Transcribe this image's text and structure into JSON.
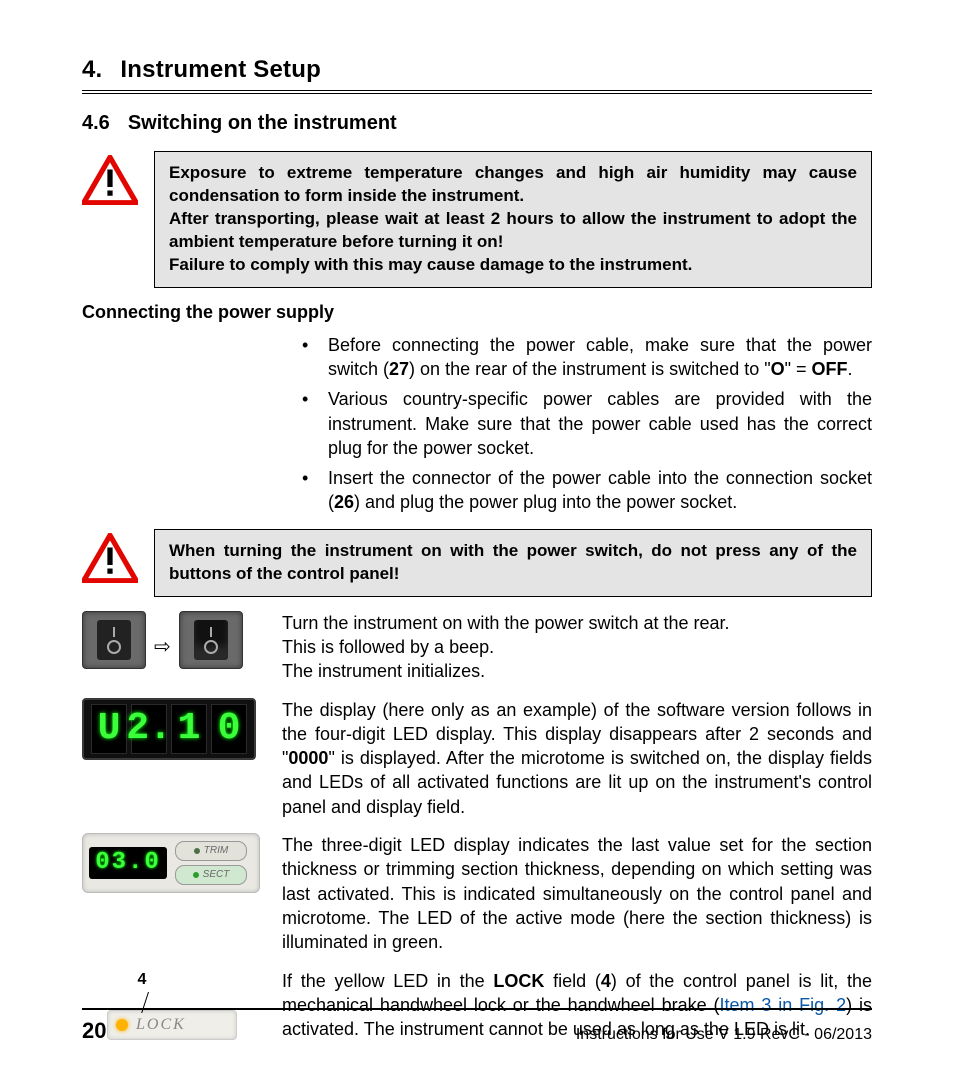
{
  "chapter": {
    "num": "4.",
    "title": "Instrument Setup"
  },
  "section": {
    "num": "4.6",
    "title": "Switching on the instrument"
  },
  "warning1": {
    "p1_a": "Exposure to extreme temperature changes and high air humidity may cause condensation to form inside the instrument.",
    "p2_a": "After transporting, please wait at least 2 hours to allow the instrument to adopt the ambient temperature before turning it on!",
    "p3_a": "Failure to comply with this may cause damage to the instrument."
  },
  "subhead": "Connecting the power supply",
  "bullets": {
    "b1_pre": "Before connecting the power cable, make sure that the power switch (",
    "b1_ref": "27",
    "b1_mid": ") on the rear of the instrument is switched to \"",
    "b1_O": "O",
    "b1_eq": "\" = ",
    "b1_OFF": "OFF",
    "b1_end": ".",
    "b2": "Various country-specific power cables are provided with the instrument. Make sure that the power cable used has the correct plug for the power socket.",
    "b3_pre": "Insert the connector of the power cable into the connection socket (",
    "b3_ref": "26",
    "b3_end": ") and plug the power plug into the power socket."
  },
  "warning2": "When turning the instrument on with the power switch, do not press any of the buttons of the control panel!",
  "para_switch": {
    "l1": "Turn the instrument on with the power switch at the rear.",
    "l2": "This is followed by a beep.",
    "l3": "The instrument initializes."
  },
  "led4_chars": [
    "U",
    "2.",
    "1",
    "0"
  ],
  "para_version_a": "The display (here only as an example) of the software version follows in the four-digit LED display. This display disappears after 2 seconds and \"",
  "para_version_b": "0000",
  "para_version_c": "\" is displayed. After the microtome is switched on, the display fields and LEDs of all activated functions are lit up on the instrument's control panel and display field.",
  "led3_value": "03.0",
  "btn_trim": "TRIM",
  "btn_sect": "SECT",
  "para_three": "The three-digit LED display indicates the last value set for the section thickness or trimming section thickness, depending on which setting was last activated. This is indicated simultaneously on the control panel and microtome. The LED of the active mode (here the section thickness) is illuminated in green.",
  "lock": {
    "callout": "4",
    "label": "LOCK",
    "p_a": "If the yellow LED in the ",
    "p_b": "LOCK",
    "p_c": " field (",
    "p_d": "4",
    "p_e": ") of the control panel is lit, the mechanical handwheel lock or the handwheel brake (",
    "p_link": "Item 3 in Fig. 2",
    "p_f": ") is activated. The instrument cannot be used as long as the LED is lit."
  },
  "footer": {
    "page": "20",
    "text": "Instructions for Use V 1.9 RevC - 06/2013"
  }
}
